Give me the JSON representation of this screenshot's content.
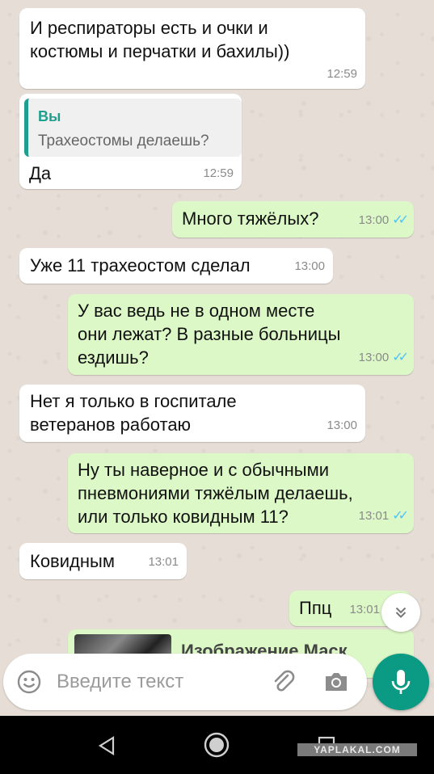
{
  "messages": [
    {
      "id": "m1",
      "direction": "in",
      "lines": [
        "И респираторы есть и очки и",
        "костюмы и перчатки и бахилы))"
      ],
      "time": "12:59"
    },
    {
      "id": "m2",
      "direction": "in",
      "quote_author": "Вы",
      "quote_text": "Трахеостомы делаешь?",
      "text": "Да",
      "time": "12:59"
    },
    {
      "id": "m3",
      "direction": "out",
      "text": "Много тяжёлых?",
      "time": "13:00"
    },
    {
      "id": "m4",
      "direction": "in",
      "text": "Уже 11 трахеостом сделал",
      "time": "13:00"
    },
    {
      "id": "m5",
      "direction": "out",
      "lines": [
        "У вас ведь не в одном месте",
        "они лежат? В разные больницы",
        "ездишь?"
      ],
      "time": "13:00"
    },
    {
      "id": "m6",
      "direction": "in",
      "lines": [
        "Нет я только в госпитале",
        "ветеранов работаю"
      ],
      "time": "13:00"
    },
    {
      "id": "m7",
      "direction": "out",
      "lines": [
        "Ну ты наверное и с обычными",
        "пневмониями тяжёлым  делаешь,",
        "или только ковидным 11?"
      ],
      "time": "13:01"
    },
    {
      "id": "m8",
      "direction": "in",
      "text": "Ковидным",
      "time": "13:01"
    },
    {
      "id": "m9",
      "direction": "out",
      "text": "Ппц",
      "time": "13:01"
    },
    {
      "id": "m10",
      "direction": "out",
      "text": "Изображение Маск",
      "time": ""
    }
  ],
  "input": {
    "placeholder": "Введите текст"
  },
  "icons": {
    "emoji": "emoji-icon",
    "attach": "paperclip-icon",
    "camera": "camera-icon",
    "mic": "mic-icon",
    "scroll_down": "chevron-double-down-icon",
    "nav_back": "back-triangle-icon",
    "nav_home": "home-circle-icon",
    "nav_recent": "recent-square-icon"
  },
  "colors": {
    "incoming": "#ffffff",
    "outgoing": "#dcf8c6",
    "accent": "#0b9a83",
    "read_ticks": "#4fc3f7"
  },
  "watermark": "YAPLAKAL.COM"
}
